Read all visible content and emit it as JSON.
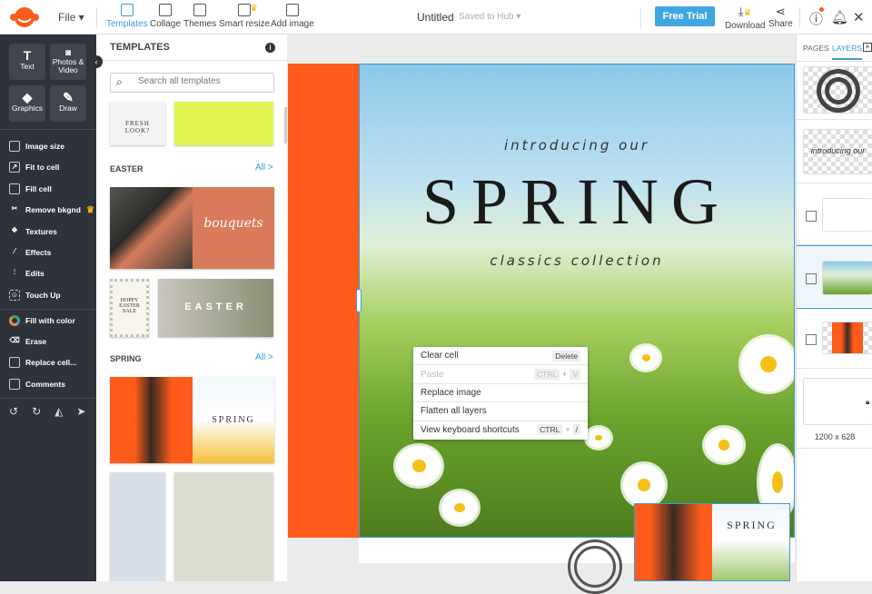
{
  "topbar": {
    "file": "File",
    "tools": [
      {
        "label": "Templates",
        "active": true
      },
      {
        "label": "Collage"
      },
      {
        "label": "Themes"
      },
      {
        "label": "Smart resize",
        "premium": true
      },
      {
        "label": "Add image"
      }
    ],
    "title": "Untitled",
    "saved": "Saved to Hub",
    "free_trial": "Free Trial",
    "download": "Download",
    "share": "Share"
  },
  "sidebar": {
    "big": [
      "Text",
      "Photos & Video",
      "Graphics",
      "Draw"
    ],
    "items": [
      "Image size",
      "Fit to cell",
      "Fill cell",
      "Remove bkgnd",
      "Textures",
      "Effects",
      "Edits",
      "Touch Up",
      "Fill with color",
      "Erase",
      "Replace cell...",
      "Comments"
    ]
  },
  "panel": {
    "title": "TEMPLATES",
    "search_placeholder": "Search all templates",
    "sections": [
      {
        "name": "EASTER",
        "all": "All >"
      },
      {
        "name": "SPRING",
        "all": "All >"
      }
    ],
    "thumbs": {
      "fresh": "FRESH LOOK?",
      "bouquets": "bouquets",
      "easter": "EASTER",
      "hoppy": "HOPPY EASTER SALE",
      "spring": "SPRING"
    }
  },
  "canvas": {
    "intro": "introducing our",
    "headline": "SPRING",
    "sub": "classics collection"
  },
  "context_menu": [
    {
      "label": "Clear cell",
      "keys": [
        "Delete"
      ]
    },
    {
      "label": "Paste",
      "keys": [
        "CTRL",
        "V"
      ],
      "disabled": true
    },
    {
      "label": "Replace image",
      "keys": []
    },
    {
      "label": "Flatten all layers",
      "keys": []
    },
    {
      "label": "View keyboard shortcuts",
      "keys": [
        "CTRL",
        "/"
      ]
    }
  ],
  "right": {
    "tabs": [
      "PAGES",
      "LAYERS"
    ],
    "layer_text": "introducing our",
    "size": "1200 x 628"
  },
  "colors": {
    "accent": "#3d9ad7",
    "orange": "#ff5b1a",
    "sidebar": "#2e323a"
  }
}
